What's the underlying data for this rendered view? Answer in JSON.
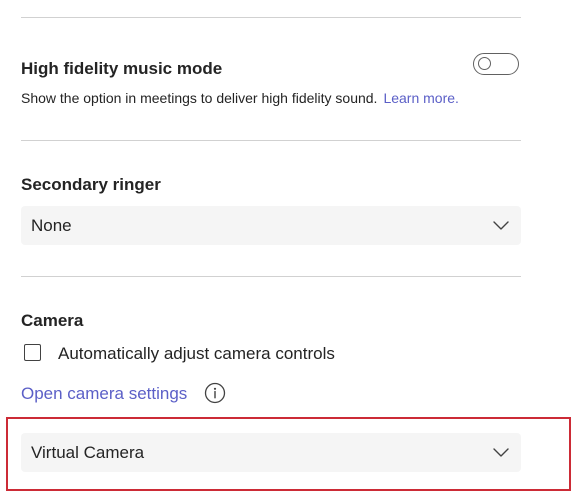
{
  "high_fidelity": {
    "title": "High fidelity music mode",
    "description": "Show the option in meetings to deliver high fidelity sound.",
    "learn_more": "Learn more.",
    "toggle_state": "off"
  },
  "secondary_ringer": {
    "title": "Secondary ringer",
    "selected": "None"
  },
  "camera": {
    "title": "Camera",
    "auto_adjust_label": "Automatically adjust camera controls",
    "auto_adjust_checked": false,
    "open_settings_label": "Open camera settings",
    "selected": "Virtual Camera"
  },
  "icons": {
    "toggle": "toggle-off-icon",
    "chevron": "chevron-down-icon",
    "info": "info-icon",
    "checkbox": "checkbox-unchecked-icon"
  },
  "colors": {
    "accent": "#5b5fc7",
    "highlight": "#cc2b36",
    "dropdown_bg": "#f5f5f5",
    "divider": "#d1d1d1"
  }
}
